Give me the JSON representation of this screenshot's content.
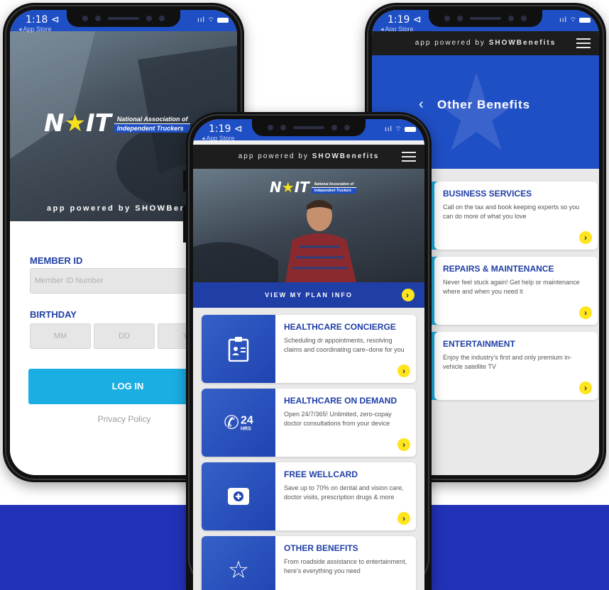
{
  "colors": {
    "brand_blue": "#1f4fc4",
    "dark_blue": "#1f3ea6",
    "accent_yellow": "#ffe51c",
    "cyan": "#1aaee3",
    "band": "#2232b8"
  },
  "logo": {
    "mark_left": "N",
    "mark_star": "★",
    "mark_right": "IT",
    "line1": "National Association of",
    "line2": "Independent Truckers"
  },
  "phone_login": {
    "status": {
      "time": "1:18 ⊲",
      "back": "◂ App Store"
    },
    "powered_by": "app powered by SHOWBene",
    "member_id_label": "MEMBER ID",
    "member_id_placeholder": "Member ID Number",
    "birthday_label": "BIRTHDAY",
    "birthday_fields": [
      "MM",
      "DD",
      "YY"
    ],
    "login_button": "LOG IN",
    "privacy_link": "Privacy Policy"
  },
  "phone_home": {
    "status": {
      "time": "1:19 ⊲",
      "back": "◂ App Store"
    },
    "topbar_prefix": "app powered by ",
    "topbar_brand": "SHOWBenefits",
    "view_plan": "VIEW MY PLAN INFO",
    "cards": [
      {
        "title": "HEALTHCARE CONCIERGE",
        "desc": "Scheduling dr appointments, resolving claims and coordinating care–done for you",
        "icon": "clipboard-id-icon"
      },
      {
        "title": "HEALTHCARE ON DEMAND",
        "desc": "Open 24/7/365! Unlimited, zero-copay doctor consultations from your device",
        "icon": "phone-24hrs-icon",
        "icon_num": "24",
        "icon_sub": "HRS"
      },
      {
        "title": "FREE WELLCARD",
        "desc": "Save up to 70% on dental and vision care, doctor visits, prescription drugs & more",
        "icon": "medical-card-icon"
      },
      {
        "title": "OTHER BENEFITS",
        "desc": "From roadside assistance to entertainment, here's everything you need",
        "icon": "star-icon"
      }
    ]
  },
  "phone_other": {
    "status": {
      "time": "1:19 ⊲",
      "back": "◂ App Store"
    },
    "topbar_prefix": "app powered by ",
    "topbar_brand": "SHOWBenefits",
    "back_glyph": "‹",
    "title": "Other Benefits",
    "cards": [
      {
        "title": "BUSINESS SERVICES",
        "desc": "Call on the tax and book keeping experts so you can do more of what you love"
      },
      {
        "title": "REPAIRS & MAINTENANCE",
        "desc": "Never feel stuck again! Get help or maintenance where and when you need it"
      },
      {
        "title": "ENTERTAINMENT",
        "desc": "Enjoy the industry's first and only premium in-vehicle satellite TV"
      }
    ]
  },
  "chevron": "›",
  "status_icons": "ııl ⌔"
}
